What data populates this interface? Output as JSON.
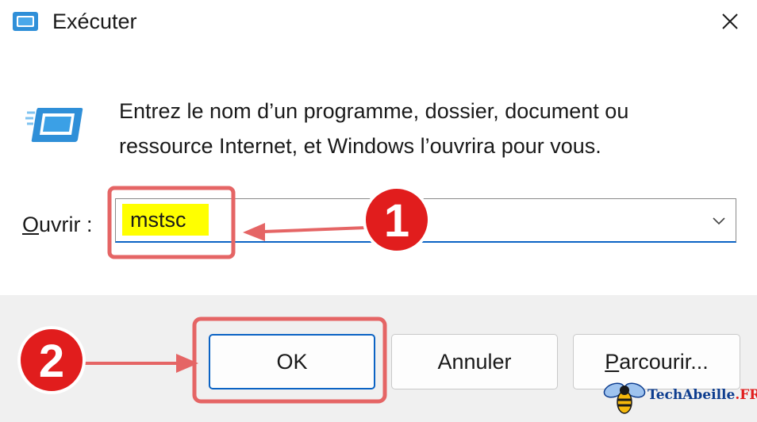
{
  "window": {
    "title": "Exécuter",
    "icon": "run-dialog-icon",
    "close_icon": "close-icon"
  },
  "content": {
    "description_line1": "Entrez le nom d’un programme, dossier, document ou",
    "description_line2": "ressource Internet, et Windows l’ouvrira pour vous.",
    "open_label_underlined": "O",
    "open_label_rest": "uvrir :",
    "input_value": "mstsc"
  },
  "buttons": {
    "ok": "OK",
    "cancel": "Annuler",
    "browse_underlined": "P",
    "browse_rest": "arcourir..."
  },
  "annotations": {
    "step1": "1",
    "step2": "2"
  },
  "watermark": {
    "text": "TechAbeille",
    "suffix": ".FR"
  },
  "colors": {
    "accent": "#0b63c4",
    "highlight": "#ffff00",
    "annotation": "#e56565",
    "badge": "#e11d1d",
    "footer_bg": "#f0f0f0"
  }
}
